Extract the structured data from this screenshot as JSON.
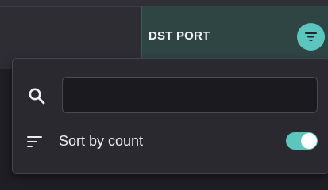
{
  "column": {
    "title": "DST PORT",
    "filter_icon": "filter-icon"
  },
  "filter_panel": {
    "search": {
      "icon": "search-icon",
      "value": "",
      "placeholder": ""
    },
    "sort": {
      "icon": "sort-icon",
      "label": "Sort by count",
      "enabled": true
    }
  },
  "colors": {
    "accent": "#5cc5bd",
    "active_header": "#2e4543",
    "panel_bg": "#2a2930",
    "page_bg": "#1f1e24"
  }
}
